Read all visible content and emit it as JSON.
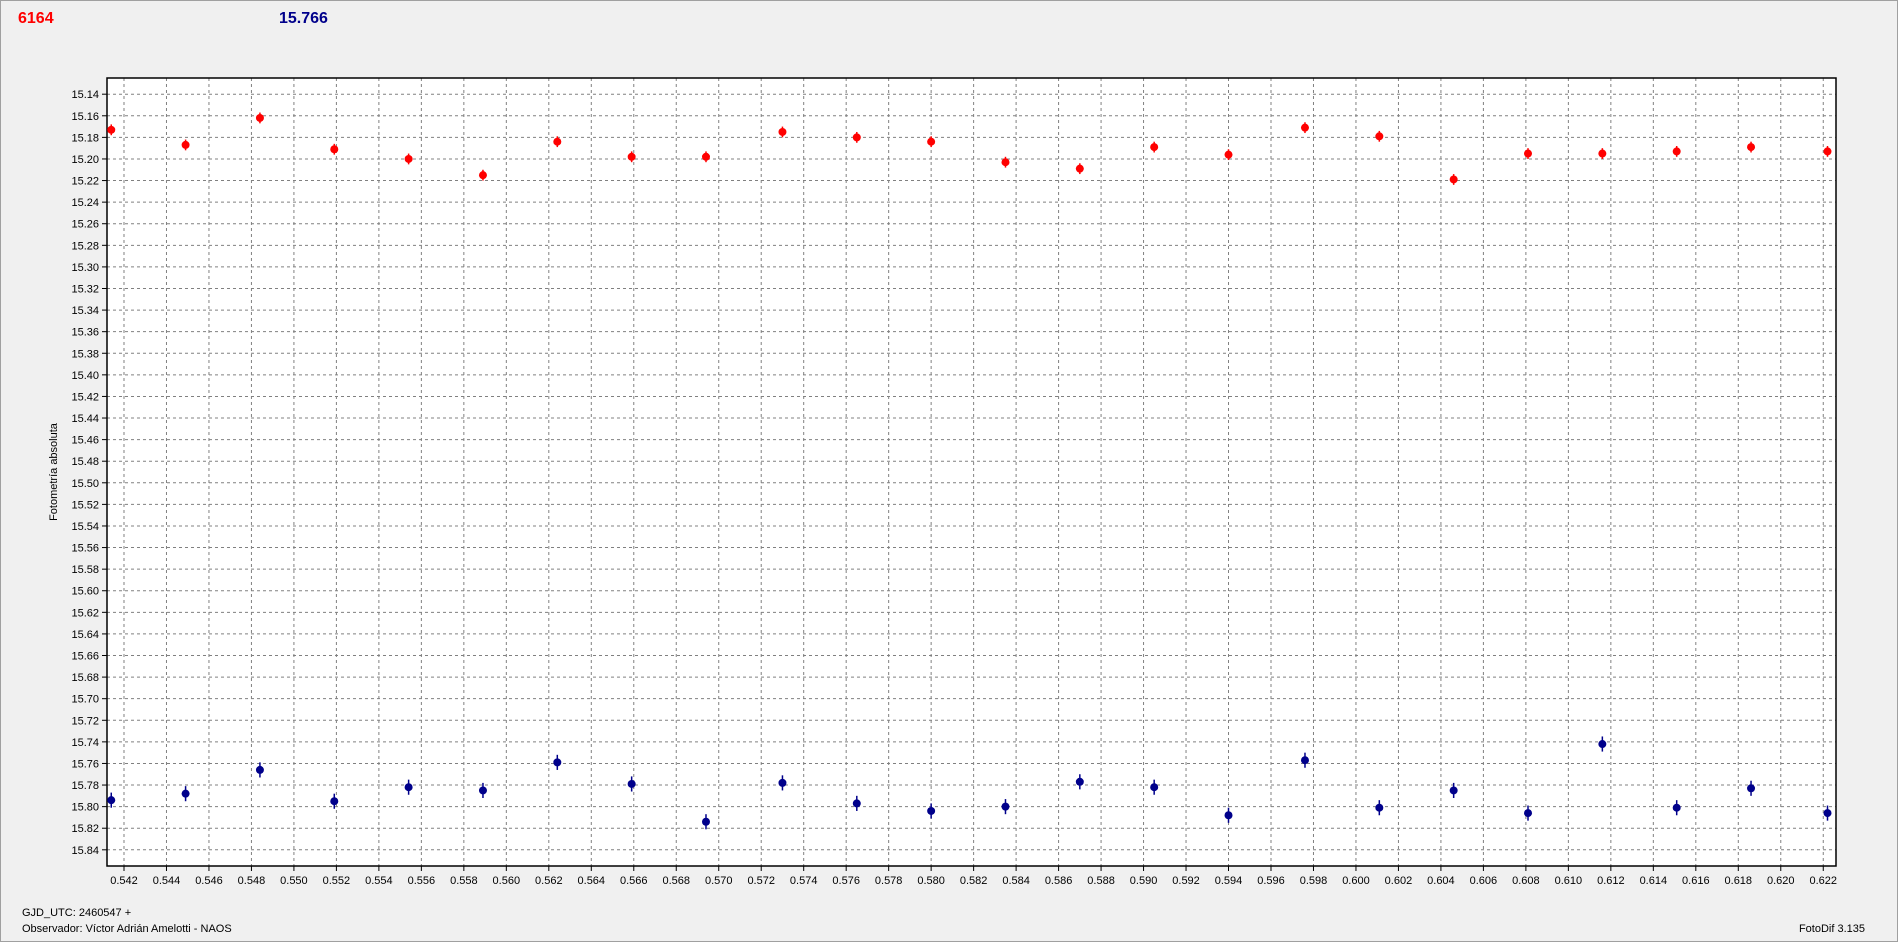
{
  "header": {
    "series_a_value": "6164",
    "series_b_value": "15.766"
  },
  "footer": {
    "gjd_label": "GJD_UTC: 2460547 +",
    "observer_label": "Observador: Víctor Adrián Amelotti - NAOS",
    "version_label": "FotoDif 3.135"
  },
  "colors": {
    "series_a": "#ff0000",
    "series_b": "#00008b",
    "grid": "#808080"
  },
  "chart_data": {
    "type": "scatter",
    "ylabel": "Fotometría absoluta",
    "xlabel": "",
    "xlim": [
      0.5412,
      0.6226
    ],
    "ylim": [
      15.855,
      15.125
    ],
    "y_inverted": true,
    "grid": true,
    "x_ticks": [
      "0.542",
      "0.544",
      "0.546",
      "0.548",
      "0.550",
      "0.552",
      "0.554",
      "0.556",
      "0.558",
      "0.560",
      "0.562",
      "0.564",
      "0.566",
      "0.568",
      "0.570",
      "0.572",
      "0.574",
      "0.576",
      "0.578",
      "0.580",
      "0.582",
      "0.584",
      "0.586",
      "0.588",
      "0.590",
      "0.592",
      "0.594",
      "0.596",
      "0.598",
      "0.600",
      "0.602",
      "0.604",
      "0.606",
      "0.608",
      "0.610",
      "0.612",
      "0.614",
      "0.616",
      "0.618",
      "0.620",
      "0.622"
    ],
    "y_ticks": [
      "15.14",
      "15.16",
      "15.18",
      "15.20",
      "15.22",
      "15.24",
      "15.26",
      "15.28",
      "15.30",
      "15.32",
      "15.34",
      "15.36",
      "15.38",
      "15.40",
      "15.42",
      "15.44",
      "15.46",
      "15.48",
      "15.50",
      "15.52",
      "15.54",
      "15.56",
      "15.58",
      "15.60",
      "15.62",
      "15.64",
      "15.66",
      "15.68",
      "15.70",
      "15.72",
      "15.74",
      "15.76",
      "15.78",
      "15.80",
      "15.82",
      "15.84"
    ],
    "series": [
      {
        "color": "#ff0000",
        "x": [
          0.5414,
          0.5449,
          0.5484,
          0.5519,
          0.5554,
          0.5589,
          0.5624,
          0.5659,
          0.5694,
          0.573,
          0.5765,
          0.58,
          0.5835,
          0.587,
          0.5905,
          0.594,
          0.5976,
          0.6011,
          0.6046,
          0.6081,
          0.6116,
          0.6151,
          0.6186,
          0.6222
        ],
        "y": [
          15.173,
          15.187,
          15.162,
          15.191,
          15.2,
          15.215,
          15.184,
          15.198,
          15.198,
          15.175,
          15.18,
          15.184,
          15.203,
          15.209,
          15.189,
          15.196,
          15.171,
          15.179,
          15.219,
          15.195,
          15.195,
          15.193,
          15.189,
          15.193
        ],
        "err": [
          0.005,
          0.005,
          0.005,
          0.005,
          0.005,
          0.005,
          0.005,
          0.005,
          0.005,
          0.005,
          0.005,
          0.005,
          0.005,
          0.005,
          0.005,
          0.005,
          0.005,
          0.005,
          0.005,
          0.005,
          0.005,
          0.005,
          0.005,
          0.005
        ]
      },
      {
        "color": "#00008b",
        "x": [
          0.5414,
          0.5449,
          0.5484,
          0.5519,
          0.5554,
          0.5589,
          0.5624,
          0.5659,
          0.5694,
          0.573,
          0.5765,
          0.58,
          0.5835,
          0.587,
          0.5905,
          0.594,
          0.5976,
          0.6011,
          0.6046,
          0.6081,
          0.6116,
          0.6151,
          0.6186,
          0.6222
        ],
        "y": [
          15.794,
          15.788,
          15.766,
          15.795,
          15.782,
          15.785,
          15.759,
          15.779,
          15.814,
          15.778,
          15.797,
          15.804,
          15.8,
          15.777,
          15.782,
          15.808,
          15.757,
          15.801,
          15.785,
          15.806,
          15.742,
          15.801,
          15.783,
          15.806
        ],
        "err": [
          0.007,
          0.007,
          0.007,
          0.007,
          0.007,
          0.007,
          0.007,
          0.007,
          0.007,
          0.007,
          0.007,
          0.007,
          0.007,
          0.007,
          0.007,
          0.007,
          0.007,
          0.007,
          0.007,
          0.007,
          0.007,
          0.007,
          0.007,
          0.007
        ]
      }
    ]
  }
}
